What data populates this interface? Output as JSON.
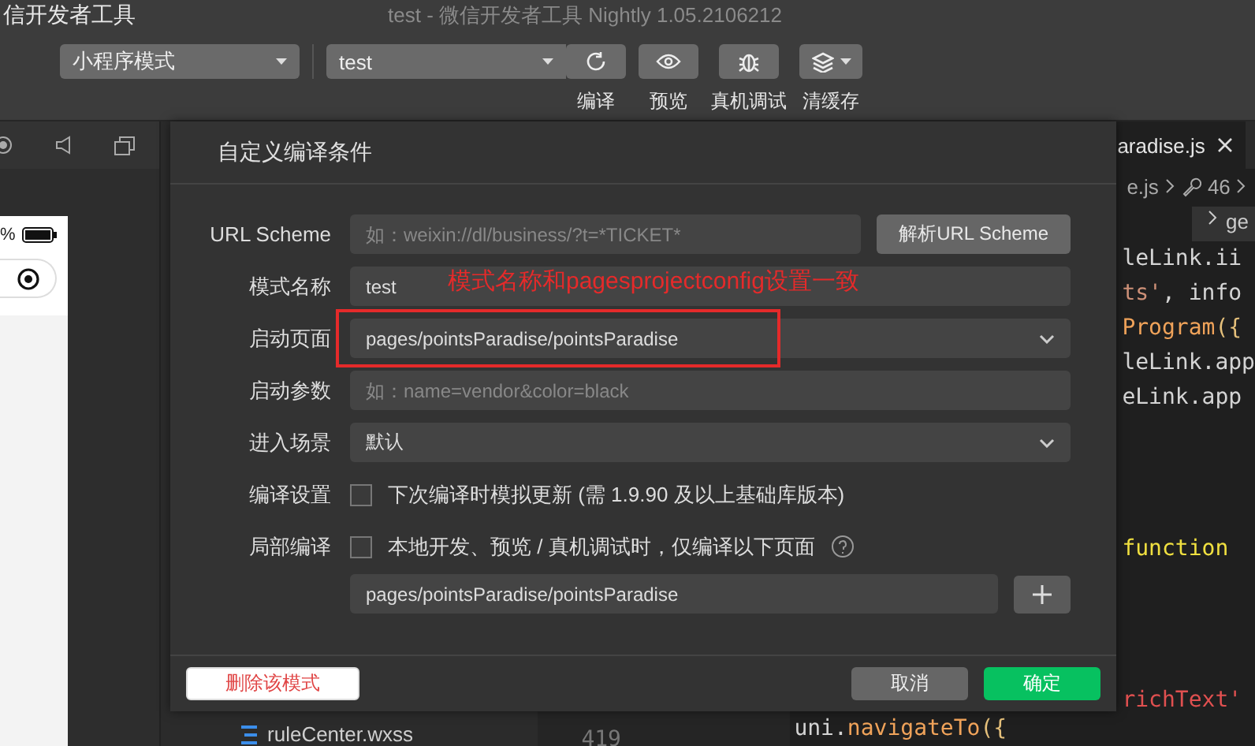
{
  "window": {
    "app_name": "信开发者工具",
    "title": "test - 微信开发者工具 Nightly 1.05.2106212"
  },
  "toolbar": {
    "mode_select": "小程序模式",
    "compile_select": "test",
    "actions": [
      {
        "kind": "refresh",
        "label": "编译"
      },
      {
        "kind": "eye",
        "label": "预览"
      },
      {
        "kind": "bug",
        "label": "真机调试"
      },
      {
        "kind": "layers",
        "label": "清缓存"
      }
    ]
  },
  "simulator": {
    "battery_text": "%"
  },
  "file_tree": {
    "items": [
      "ruleCenter.wxss"
    ]
  },
  "editor": {
    "tab": "aradise.js",
    "breadcrumb": [
      "e.js",
      "46"
    ],
    "side_tab": "ge",
    "line_number": "419",
    "top_lines": [
      [
        {
          "kind": "plain",
          "text": "leLink.ii"
        }
      ],
      [
        {
          "kind": "string",
          "text": "ts'"
        },
        {
          "kind": "plain",
          "text": ", info"
        }
      ],
      [
        {
          "kind": "func",
          "text": "Program"
        },
        {
          "kind": "bracket",
          "text": "({"
        }
      ],
      [
        {
          "kind": "plain",
          "text": "leLink.app"
        }
      ],
      [
        {
          "kind": "plain",
          "text": "eLink.app"
        }
      ]
    ],
    "middle_lines": [
      [
        {
          "kind": "keyword",
          "text": "function"
        }
      ]
    ],
    "bottom_lines": [
      [
        {
          "kind": "red",
          "text": "richText'"
        }
      ]
    ],
    "last_line": [
      {
        "kind": "plain",
        "text": "uni."
      },
      {
        "kind": "func",
        "text": "navigateTo"
      },
      {
        "kind": "bracket",
        "text": "({"
      }
    ]
  },
  "dialog": {
    "title": "自定义编译条件",
    "fields": [
      {
        "kind": "text",
        "label": "URL Scheme",
        "placeholder": "如：weixin://dl/business/?t=*TICKET*",
        "button": "解析URL Scheme"
      },
      {
        "kind": "text",
        "label": "模式名称",
        "value": "test"
      },
      {
        "kind": "select",
        "label": "启动页面",
        "value": "pages/pointsParadise/pointsParadise"
      },
      {
        "kind": "text",
        "label": "启动参数",
        "placeholder": "如：name=vendor&color=black"
      },
      {
        "kind": "select",
        "label": "进入场景",
        "value": "默认"
      },
      {
        "kind": "checkbox",
        "label": "编译设置",
        "text": "下次编译时模拟更新 (需 1.9.90 及以上基础库版本)",
        "checked": false
      },
      {
        "kind": "checkbox",
        "label": "局部编译",
        "text": "本地开发、预览 / 真机调试时，仅编译以下页面",
        "checked": false,
        "help": true,
        "pages_value": "pages/pointsParadise/pointsParadise"
      }
    ],
    "delete_button": "删除该模式",
    "cancel_button": "取消",
    "confirm_button": "确定"
  },
  "annotation": {
    "text": "模式名称和pagesprojectconfig设置一致"
  }
}
